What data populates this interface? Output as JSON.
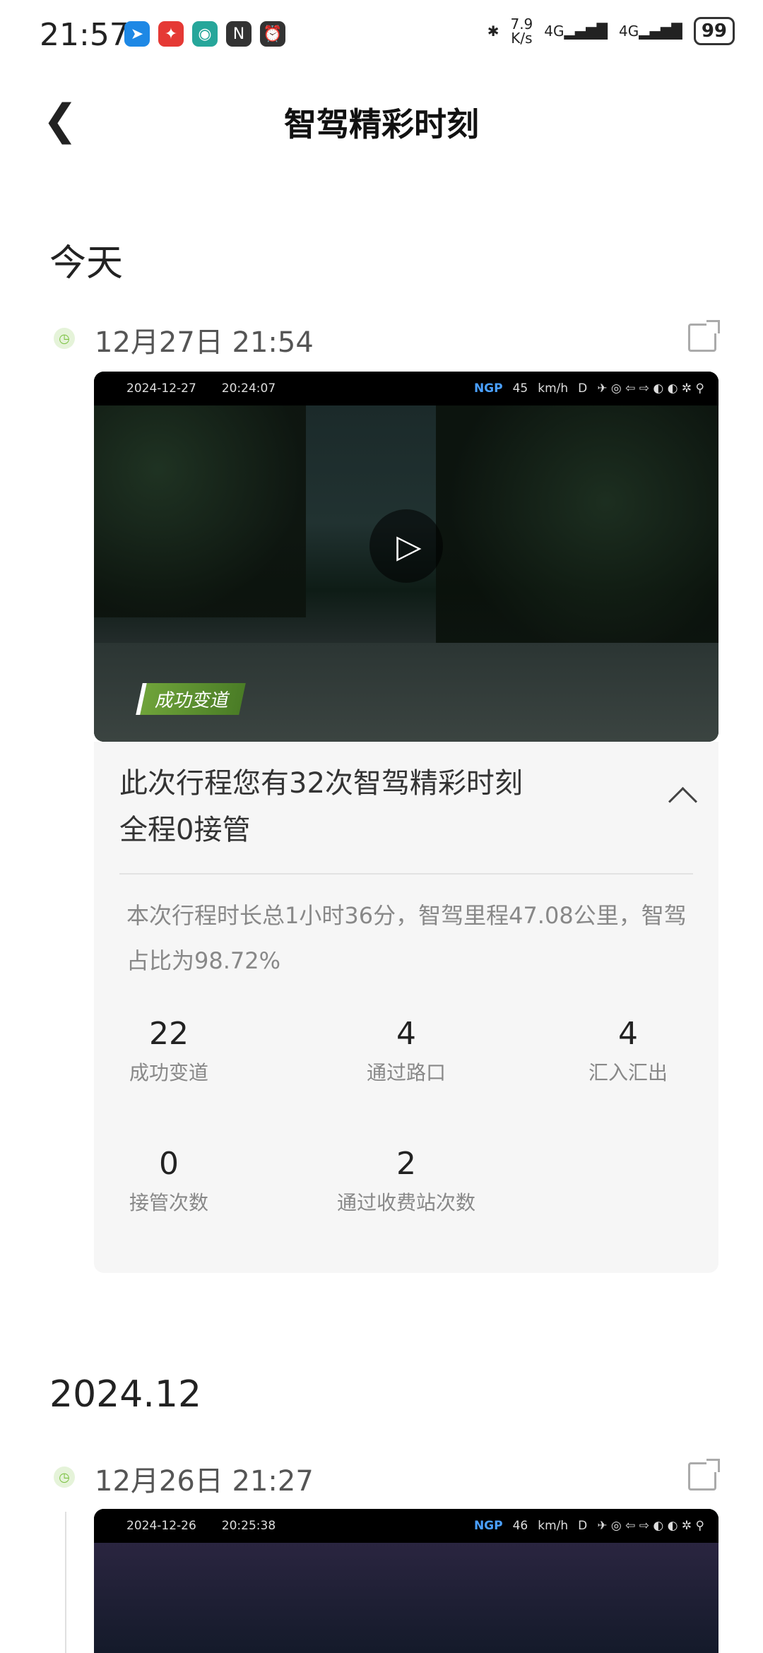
{
  "status_bar": {
    "time": "21:57",
    "net_speed_value": "7.9",
    "net_speed_unit": "K/s",
    "signal1": "4G",
    "signal2": "4G",
    "battery": "99"
  },
  "header": {
    "title": "智驾精彩时刻",
    "back_icon": "chevron-left-icon"
  },
  "sections": [
    {
      "label": "今天"
    },
    {
      "label": "2024.12"
    }
  ],
  "entries": [
    {
      "time": "12月27日 21:54",
      "osd_date": "2024-12-27",
      "osd_time": "20:24:07",
      "osd_speed": "45",
      "osd_unit": "km/h",
      "osd_gear": "D",
      "osd_ngp": "NGP",
      "tag": "成功变道"
    },
    {
      "time": "12月26日 21:27",
      "osd_date": "2024-12-26",
      "osd_time": "20:25:38",
      "osd_speed": "46",
      "osd_unit": "km/h",
      "osd_gear": "D",
      "osd_ngp": "NGP"
    }
  ],
  "card": {
    "summary_line1": "此次行程您有32次智驾精彩时刻",
    "summary_line2": "全程0接管",
    "description": "本次行程时长总1小时36分，智驾里程47.08公里，智驾占比为98.72%",
    "stats": [
      {
        "value": "22",
        "label": "成功变道"
      },
      {
        "value": "4",
        "label": "通过路口"
      },
      {
        "value": "4",
        "label": "汇入汇出"
      },
      {
        "value": "0",
        "label": "接管次数"
      },
      {
        "value": "2",
        "label": "通过收费站次数"
      }
    ]
  }
}
